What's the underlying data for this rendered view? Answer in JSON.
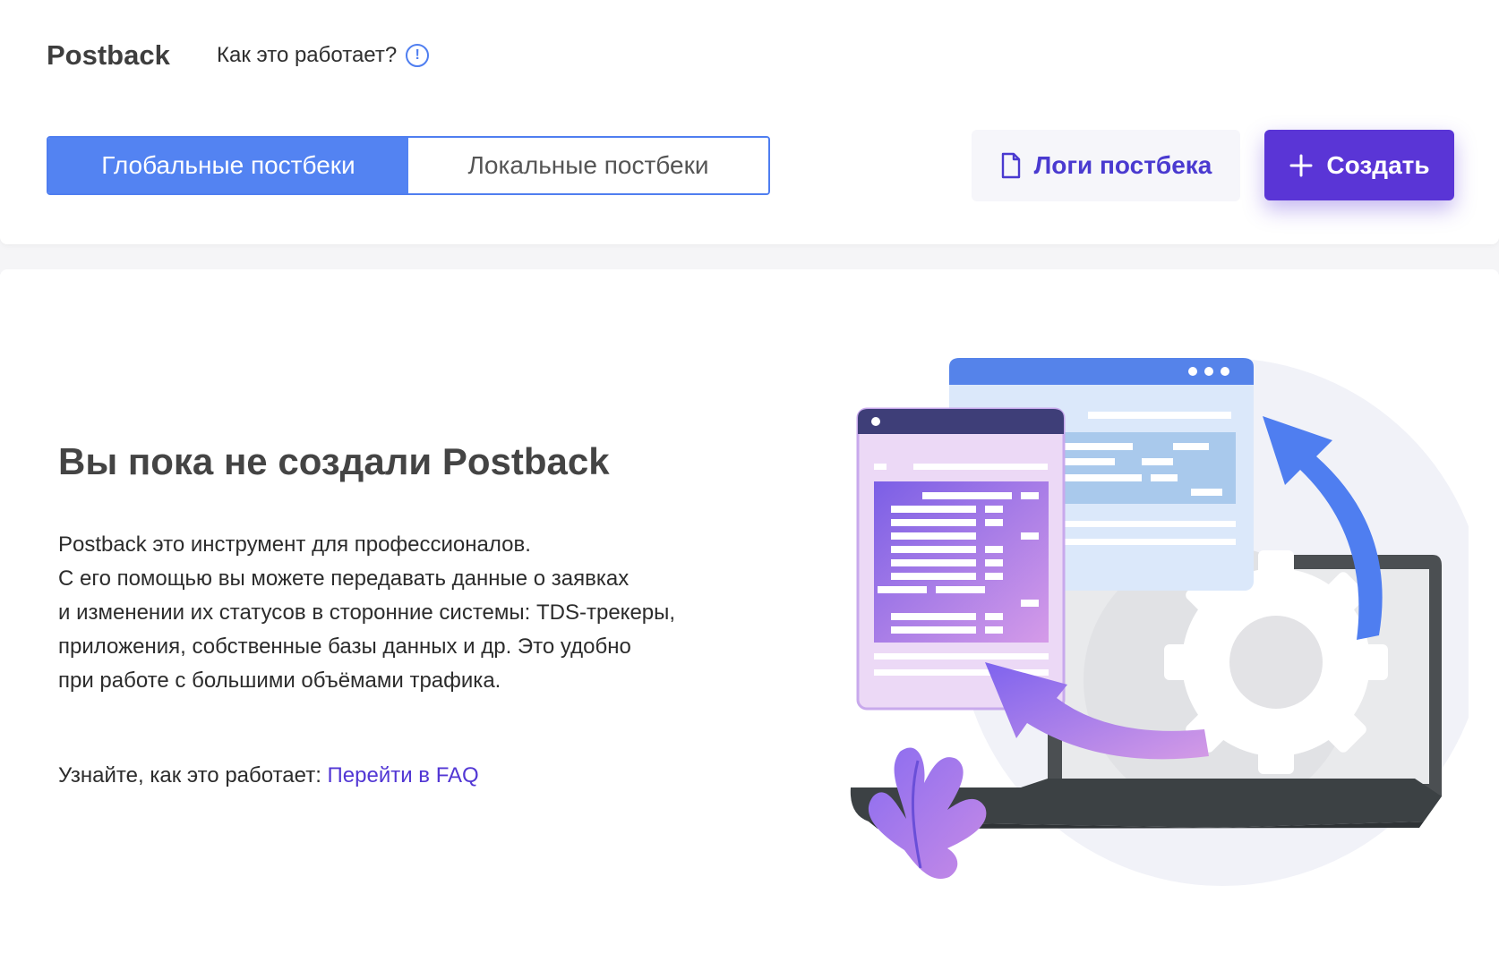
{
  "header": {
    "title": "Postback",
    "how_it_works": "Как это работает?",
    "info_icon": "!"
  },
  "tabs": [
    {
      "label": "Глобальные постбеки",
      "active": true
    },
    {
      "label": "Локальные постбеки",
      "active": false
    }
  ],
  "toolbar": {
    "logs_label": "Логи постбека",
    "logs_icon": "document-icon",
    "create_label": "Создать",
    "create_icon": "plus-icon"
  },
  "empty_state": {
    "title": "Вы пока не создали Postback",
    "description_lines": [
      "Postback это инструмент для профессионалов.",
      "С его помощью вы можете передавать данные о заявках",
      "и изменении их статусов в сторонние системы: TDS-трекеры,",
      "приложения, собственные базы данных и др. Это удобно",
      "при работе с большими объёмами трафика."
    ],
    "faq_prefix": "Узнайте, как это работает: ",
    "faq_link": "Перейти в FAQ"
  },
  "colors": {
    "accent_blue": "#5383f2",
    "accent_purple": "#5a35d6",
    "link": "#5237d4"
  }
}
